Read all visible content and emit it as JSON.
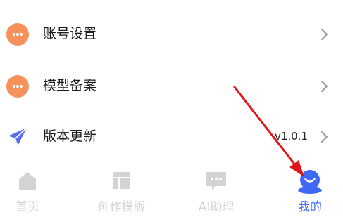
{
  "menu": {
    "items": [
      {
        "icon": "more-dots-icon",
        "label": "账号设置",
        "value": ""
      },
      {
        "icon": "more-dots-icon",
        "label": "模型备案",
        "value": ""
      },
      {
        "icon": "paper-plane-icon",
        "label": "版本更新",
        "value": "v1.0.1"
      }
    ]
  },
  "tabbar": {
    "tabs": [
      {
        "icon": "home-icon",
        "label": "首页",
        "active": false
      },
      {
        "icon": "template-icon",
        "label": "创作模版",
        "active": false
      },
      {
        "icon": "chat-icon",
        "label": "AI助理",
        "active": false
      },
      {
        "icon": "profile-icon",
        "label": "我的",
        "active": true
      }
    ]
  },
  "colors": {
    "accent": "#3f68f5",
    "dots_icon": "#f5915a",
    "plane_icon": "#5b6cf0",
    "inactive": "#d3d3d3",
    "annotation_arrow": "#e0161b"
  }
}
